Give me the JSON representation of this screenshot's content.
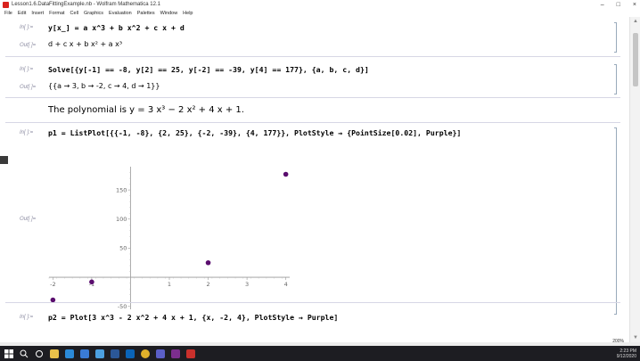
{
  "window": {
    "title": "Lesson1.6.DataFittingExample.nb - Wolfram Mathematica 12.1",
    "controls": [
      "–",
      "□",
      "×"
    ]
  },
  "menu": [
    "File",
    "Edit",
    "Insert",
    "Format",
    "Cell",
    "Graphics",
    "Evaluation",
    "Palettes",
    "Window",
    "Help"
  ],
  "cells": {
    "in1_label": "In[ ]:=",
    "in1_code": "y[x_] = a x^3 + b x^2 + c x + d",
    "out1_label": "Out[ ]=",
    "out1": "d + c x + b x² + a x³",
    "in2_label": "In[ ]:=",
    "in2_code": "Solve[{y[-1] == -8, y[2] == 25, y[-2] == -39, y[4] == 177}, {a, b, c, d}]",
    "out2_label": "Out[ ]=",
    "out2": "{{a → 3, b → -2, c → 4, d → 1}}",
    "text1": "The polynomial is y = 3 x³ − 2 x² + 4 x + 1.",
    "in3_label": "In[ ]:=",
    "in3_code": "p1 = ListPlot[{{-1, -8}, {2, 25}, {-2, -39}, {4, 177}}, PlotStyle → {PointSize[0.02], Purple}]",
    "out3_label": "Out[ ]=",
    "in4_label": "In[ ]:=",
    "in4_code": "p2 = Plot[3 x^3 - 2 x^2 + 4 x + 1, {x, -2, 4}, PlotStyle → Purple]"
  },
  "chart_data": {
    "type": "scatter",
    "x": [
      -1,
      2,
      -2,
      4
    ],
    "y": [
      -8,
      25,
      -39,
      177
    ],
    "x_ticks": [
      -2,
      -1,
      1,
      2,
      3,
      4
    ],
    "y_ticks": [
      150,
      100,
      50,
      -50
    ],
    "xlim": [
      -2.1,
      4.1
    ],
    "ylim": [
      -55,
      190
    ],
    "color": "#5a0d6e",
    "title": "",
    "xlabel": "",
    "ylabel": ""
  },
  "status": {
    "zoom": "200%",
    "time": "2:23 PM",
    "date": "9/12/2020"
  },
  "taskbar_icons": [
    "windows-icon",
    "search-icon",
    "task-view-icon",
    "explorer-icon",
    "edge-icon",
    "store-icon",
    "mail-icon",
    "word-icon",
    "outlook-icon",
    "chrome-icon",
    "teams-icon",
    "onenote-icon",
    "mathematica-icon"
  ]
}
